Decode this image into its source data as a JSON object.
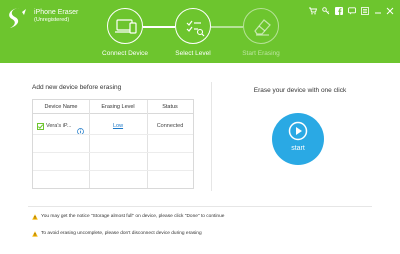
{
  "app": {
    "title": "iPhone Eraser",
    "subtitle": "(Unregistered)"
  },
  "window_controls": [
    "cart-icon",
    "key-icon",
    "facebook-icon",
    "chat-icon",
    "menu-icon",
    "minimize-icon",
    "close-icon"
  ],
  "steps": [
    {
      "label": "Connect Device",
      "icon": "laptop-phone-icon",
      "state": "done"
    },
    {
      "label": "Select Level",
      "icon": "checklist-icon",
      "state": "active"
    },
    {
      "label": "Start Erasing",
      "icon": "eraser-icon",
      "state": "disabled"
    }
  ],
  "left_panel": {
    "title": "Add new device before erasing",
    "columns": [
      "Device Name",
      "Erasing Level",
      "Status"
    ],
    "rows": [
      {
        "device": "Vera's iP...",
        "level": "Low",
        "status": "Connected",
        "checked": true
      }
    ]
  },
  "right_panel": {
    "title": "Erase your device with one click",
    "start_label": "start"
  },
  "notices": [
    "You may get the notice \"Storage almost full\" on device, please click \"Done\" to continue",
    "To avoid erasing uncomplete, please don't disconnect device during erasing"
  ],
  "colors": {
    "header_green": "#6dc52e",
    "start_blue": "#2aa9e4",
    "link_blue": "#1b78c8",
    "warning_yellow": "#f5b400"
  }
}
